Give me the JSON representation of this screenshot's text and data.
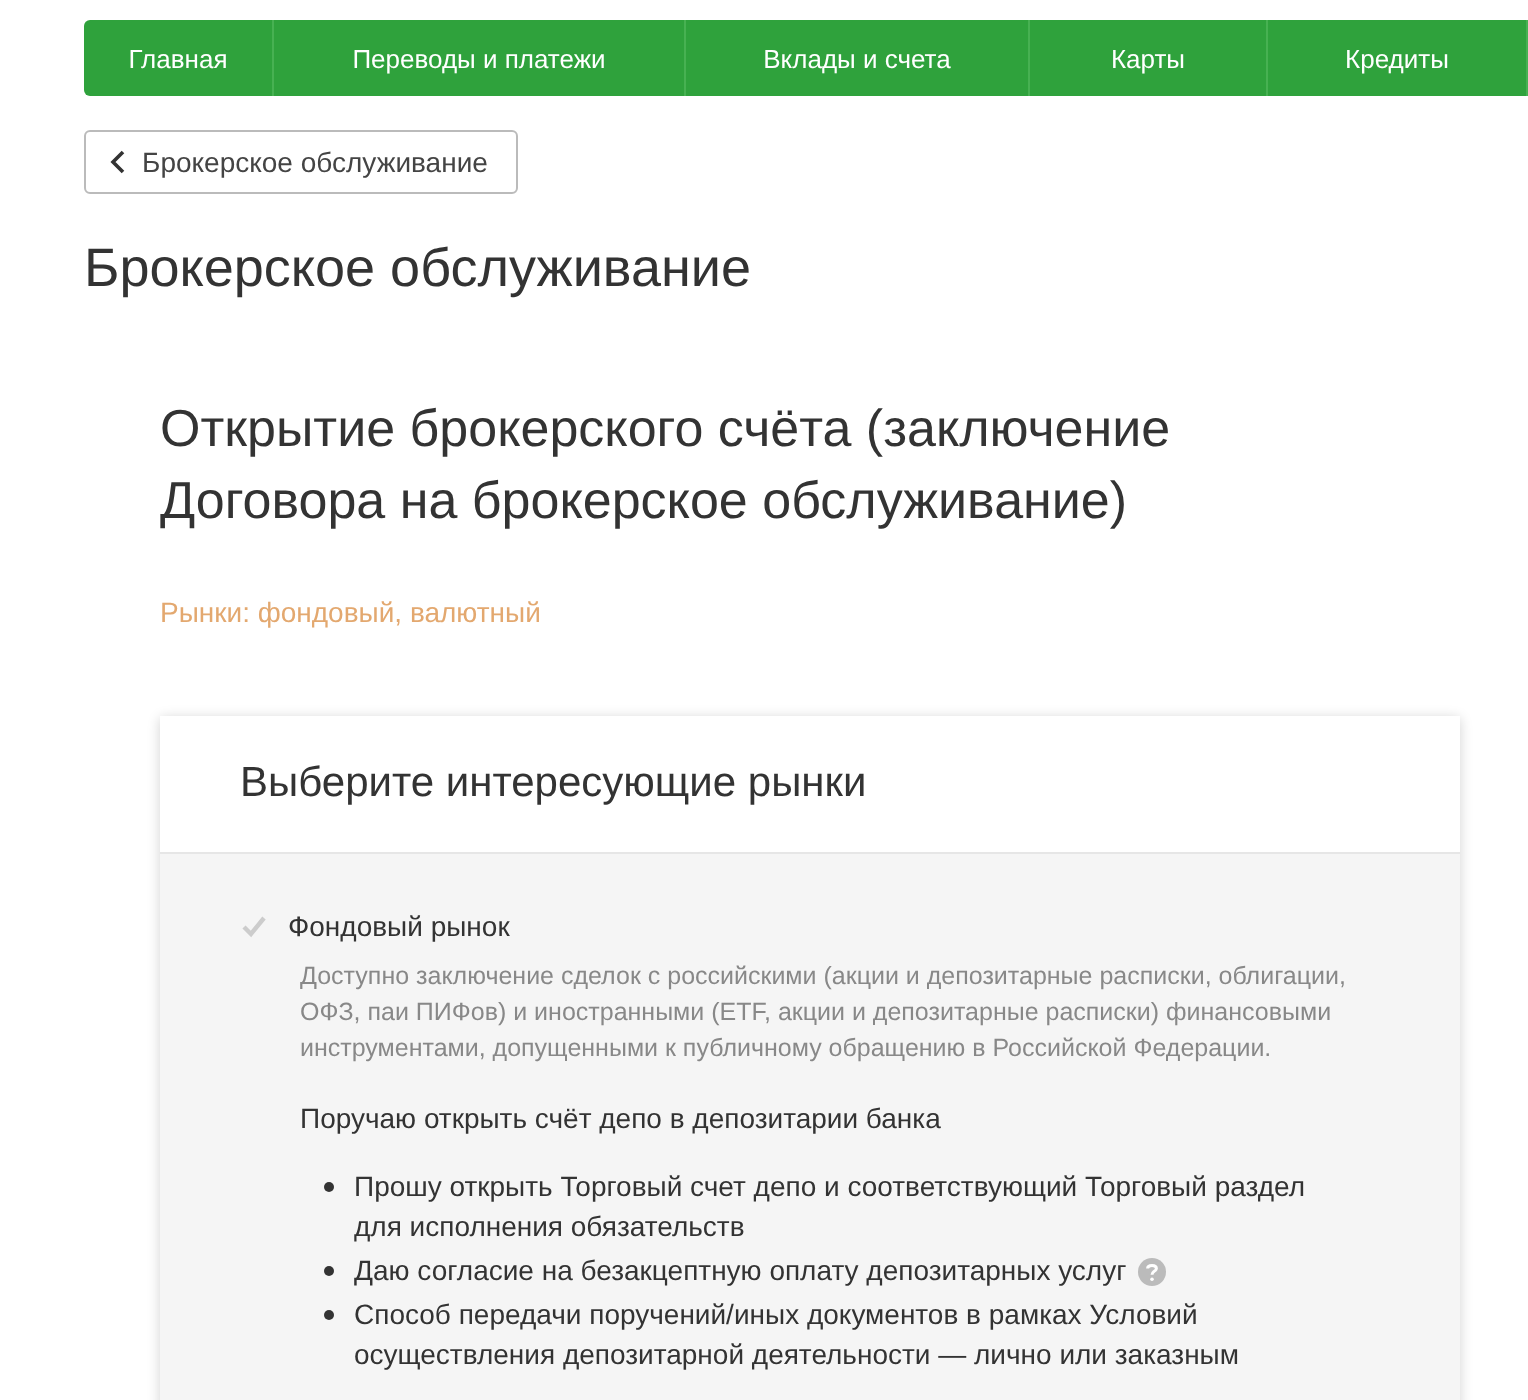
{
  "nav": [
    {
      "label": "Главная"
    },
    {
      "label": "Переводы и платежи"
    },
    {
      "label": "Вклады и счета"
    },
    {
      "label": "Карты"
    },
    {
      "label": "Кредиты"
    }
  ],
  "back_button": {
    "label": "Брокерское обслуживание"
  },
  "page_title": "Брокерское обслуживание",
  "section_title": "Открытие брокерского счёта (заключение Договора на брокерское обслуживание)",
  "markets_note": "Рынки: фондовый, валютный",
  "card": {
    "title": "Выберите интересующие рынки",
    "options": [
      {
        "label": "Фондовый рынок",
        "checked": true,
        "disabled": true,
        "description": "Доступно заключение сделок с российскими (акции и депозитарные расписки, облигации, ОФЗ, паи ПИФов) и иностранными (ETF, акции и депозитарные расписки) финансовыми инструментами, допущенными к публичному обращению в Российской Федерации.",
        "instruction": "Поручаю открыть счёт депо в депозитарии банка",
        "bullets": [
          {
            "text": "Прошу открыть Торговый счет депо и соответствующий Торговый раздел для исполнения обязательств",
            "help": false
          },
          {
            "text": "Даю согласие на безакцептную оплату депозитарных услуг",
            "help": true
          },
          {
            "text": "Способ передачи поручений/иных документов в рамках Условий осуществления депозитарной деятельности — лично или заказным",
            "help": false
          }
        ]
      }
    ]
  }
}
